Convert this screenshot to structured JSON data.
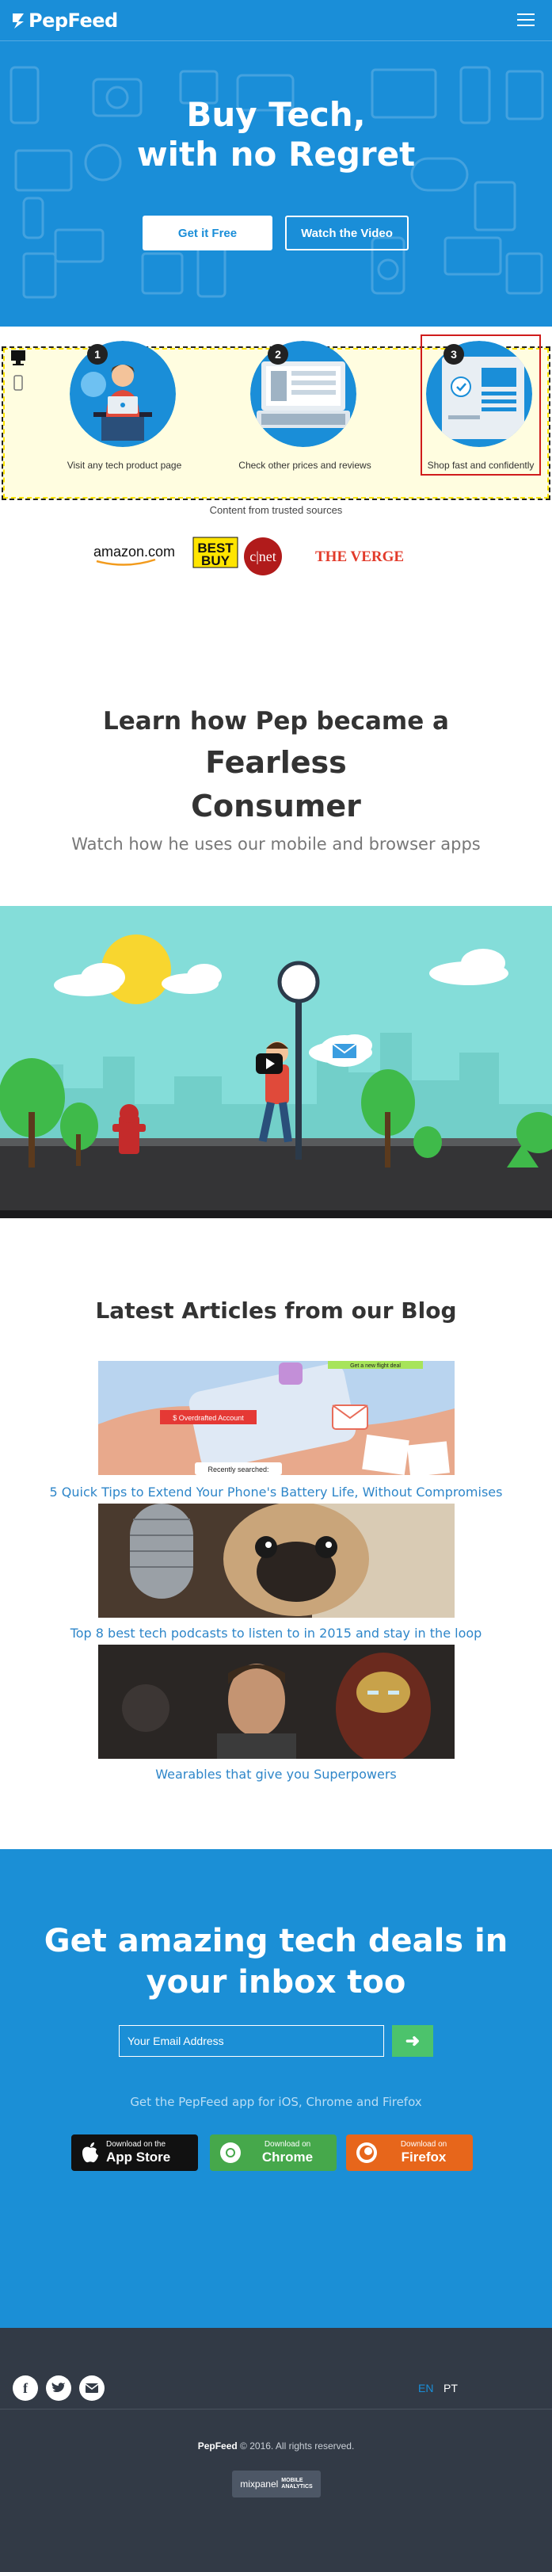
{
  "header": {
    "logo_text": "PepFeed"
  },
  "hero": {
    "title_line1": "Buy Tech,",
    "title_line2": "with no Regret",
    "cta_primary": "Get it Free",
    "cta_secondary": "Watch the Video"
  },
  "steps": [
    {
      "number": "1",
      "label": "Visit any tech product page"
    },
    {
      "number": "2",
      "label": "Check other prices and reviews"
    },
    {
      "number": "3",
      "label": "Shop fast and confidently"
    }
  ],
  "trusted": {
    "caption": "Content from trusted sources",
    "brands": [
      "amazon.com",
      "BEST BUY",
      "c|net",
      "THE VERGE"
    ]
  },
  "fearless": {
    "title_pre": "Learn how Pep became a",
    "title_bold1": "Fearless",
    "title_bold2": "Consumer",
    "subtitle": "Watch how he uses our mobile and browser apps"
  },
  "blog": {
    "title": "Latest Articles from our Blog",
    "articles": [
      {
        "title": "5 Quick Tips to Extend Your Phone's Battery Life, Without Compromises",
        "img_tags": [
          "$ Overdrafted Account",
          "Recently searched:",
          "Get a new flight deal"
        ]
      },
      {
        "title": "Top 8 best tech podcasts to listen to in 2015 and stay in the loop"
      },
      {
        "title": "Wearables that give you Superpowers"
      }
    ]
  },
  "newsletter": {
    "title_line1": "Get amazing tech deals in",
    "title_line2": "your inbox too",
    "email_placeholder": "Your Email Address",
    "apps_text": "Get the PepFeed app for iOS, Chrome and Firefox",
    "stores": [
      {
        "small": "Download on the",
        "big": "App Store",
        "color": "#111111"
      },
      {
        "small": "Download on",
        "big": "Chrome",
        "color": "#46a84b"
      },
      {
        "small": "Download on",
        "big": "Firefox",
        "color": "#e7661b"
      }
    ]
  },
  "footer": {
    "lang_en": "EN",
    "lang_pt": "PT",
    "brand": "PepFeed",
    "copyright": "© 2016. All rights reserved.",
    "mixpanel_name": "mixpanel",
    "mixpanel_badge_line1": "MOBILE",
    "mixpanel_badge_line2": "ANALYTICS"
  },
  "colors": {
    "hero_blue": "#1a8ed8",
    "footer_dark": "#323a46",
    "link_blue": "#2e86c9",
    "lang_active": "#1a8ed8"
  }
}
